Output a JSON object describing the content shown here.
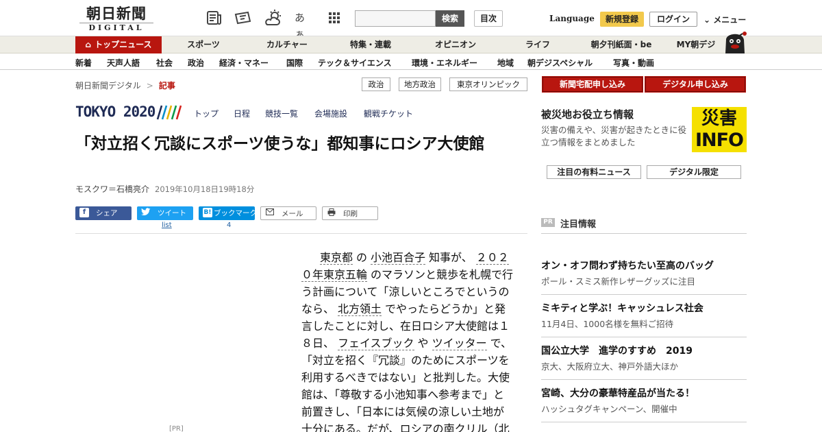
{
  "header": {
    "logo_jp": "朝日新聞",
    "logo_en": "DIGITAL",
    "search_button": "検索",
    "index_button": "目次",
    "language": "Language",
    "register": "新規登録",
    "login": "ログイン",
    "menu": "メニュー",
    "icons": [
      "newspaper-icon",
      "ticket-icon",
      "weather-icon",
      "font-size-icon",
      "grid-apps-icon"
    ],
    "font_icon_text": "あぁ"
  },
  "nav_main": [
    "トップニュース",
    "スポーツ",
    "カルチャー",
    "特集・連載",
    "オピニオン",
    "ライフ",
    "朝夕刊紙面・be",
    "MY朝デジ"
  ],
  "nav_sub": [
    "新着",
    "天声人語",
    "社会",
    "政治",
    "経済・マネー",
    "国際",
    "テック＆サイエンス",
    "環境・エネルギー",
    "地域",
    "朝デジスペシャル",
    "写真・動画"
  ],
  "breadcrumb": {
    "home": "朝日新聞デジタル",
    "sep": ">",
    "current": "記事"
  },
  "tags": [
    "政治",
    "地方政治",
    "東京オリンピック"
  ],
  "olympics": {
    "logo": "TOKYO 2020",
    "links": [
      "トップ",
      "日程",
      "競技一覧",
      "会場施設",
      "観戦チケット"
    ]
  },
  "article": {
    "title": "「対立招く冗談にスポーツ使うな」都知事にロシア大使館",
    "author": "モスクワ＝石橋亮介",
    "date": "2019年10月18日19時18分",
    "share": {
      "facebook": "シェア",
      "twitter": "ツイート",
      "twitter_count": "list",
      "hatena": "ブックマーク",
      "hatena_count": "4",
      "mail": "メール",
      "print": "印刷"
    },
    "body": {
      "t1": "東京都",
      "t2": "の",
      "t3": "小池百合子",
      "t4": "知事が、",
      "t5": "２０２０年東京五輪",
      "t6": "のマラソンと競歩を札幌で行う計画について「涼しいところでというのなら、",
      "t7": "北方領土",
      "t8": "でやったらどうか」と発言したことに対し、在日ロシア大使館は１８日、",
      "t9": "フェイスブック",
      "t10": "や",
      "t11": "ツイッター",
      "t12": "で、「対立を招く『冗談』のためにスポーツを利用するべきではない」と批判した。大使館は、「尊敬する小池知事へ参考まで」と前置きし、「日本には気候の涼しい土地が十分にある。だが、ロシアの南クリル（北"
    },
    "pr_label": "[PR]"
  },
  "sidebar": {
    "buttons": [
      "新聞宅配申し込み",
      "デジタル申し込み"
    ],
    "disaster": {
      "title": "被災地お役立ち情報",
      "desc": "災害の備えや、災害が起きたときに役立つ情報をまとめました",
      "badge_top": "災害",
      "badge_bottom": "INFO"
    },
    "tabs": [
      "注目の有料ニュース",
      "デジタル限定"
    ],
    "pr_header": {
      "badge": "PR",
      "label": "注目情報"
    },
    "pr_items": [
      {
        "title": "オン・オフ問わず持ちたい至高のバッグ",
        "sub": "ポール・スミス新作レザーグッズに注目"
      },
      {
        "title": "ミキティと学ぶ！キャッシュレス社会",
        "sub": "11月4日、1000名様を無料ご招待"
      },
      {
        "title": "国公立大学　進学のすすめ　2019",
        "sub": "京大、大阪府立大、神戸外語大ほか"
      },
      {
        "title": "宮崎、大分の豪華特産品が当たる！",
        "sub": "ハッシュタグキャンペーン、開催中"
      }
    ]
  },
  "colors": {
    "brand_red": "#b8160f",
    "nav_bg": "#eeede5",
    "register_yellow": "#f2c94c",
    "olympic_navy": "#1f2b55"
  }
}
